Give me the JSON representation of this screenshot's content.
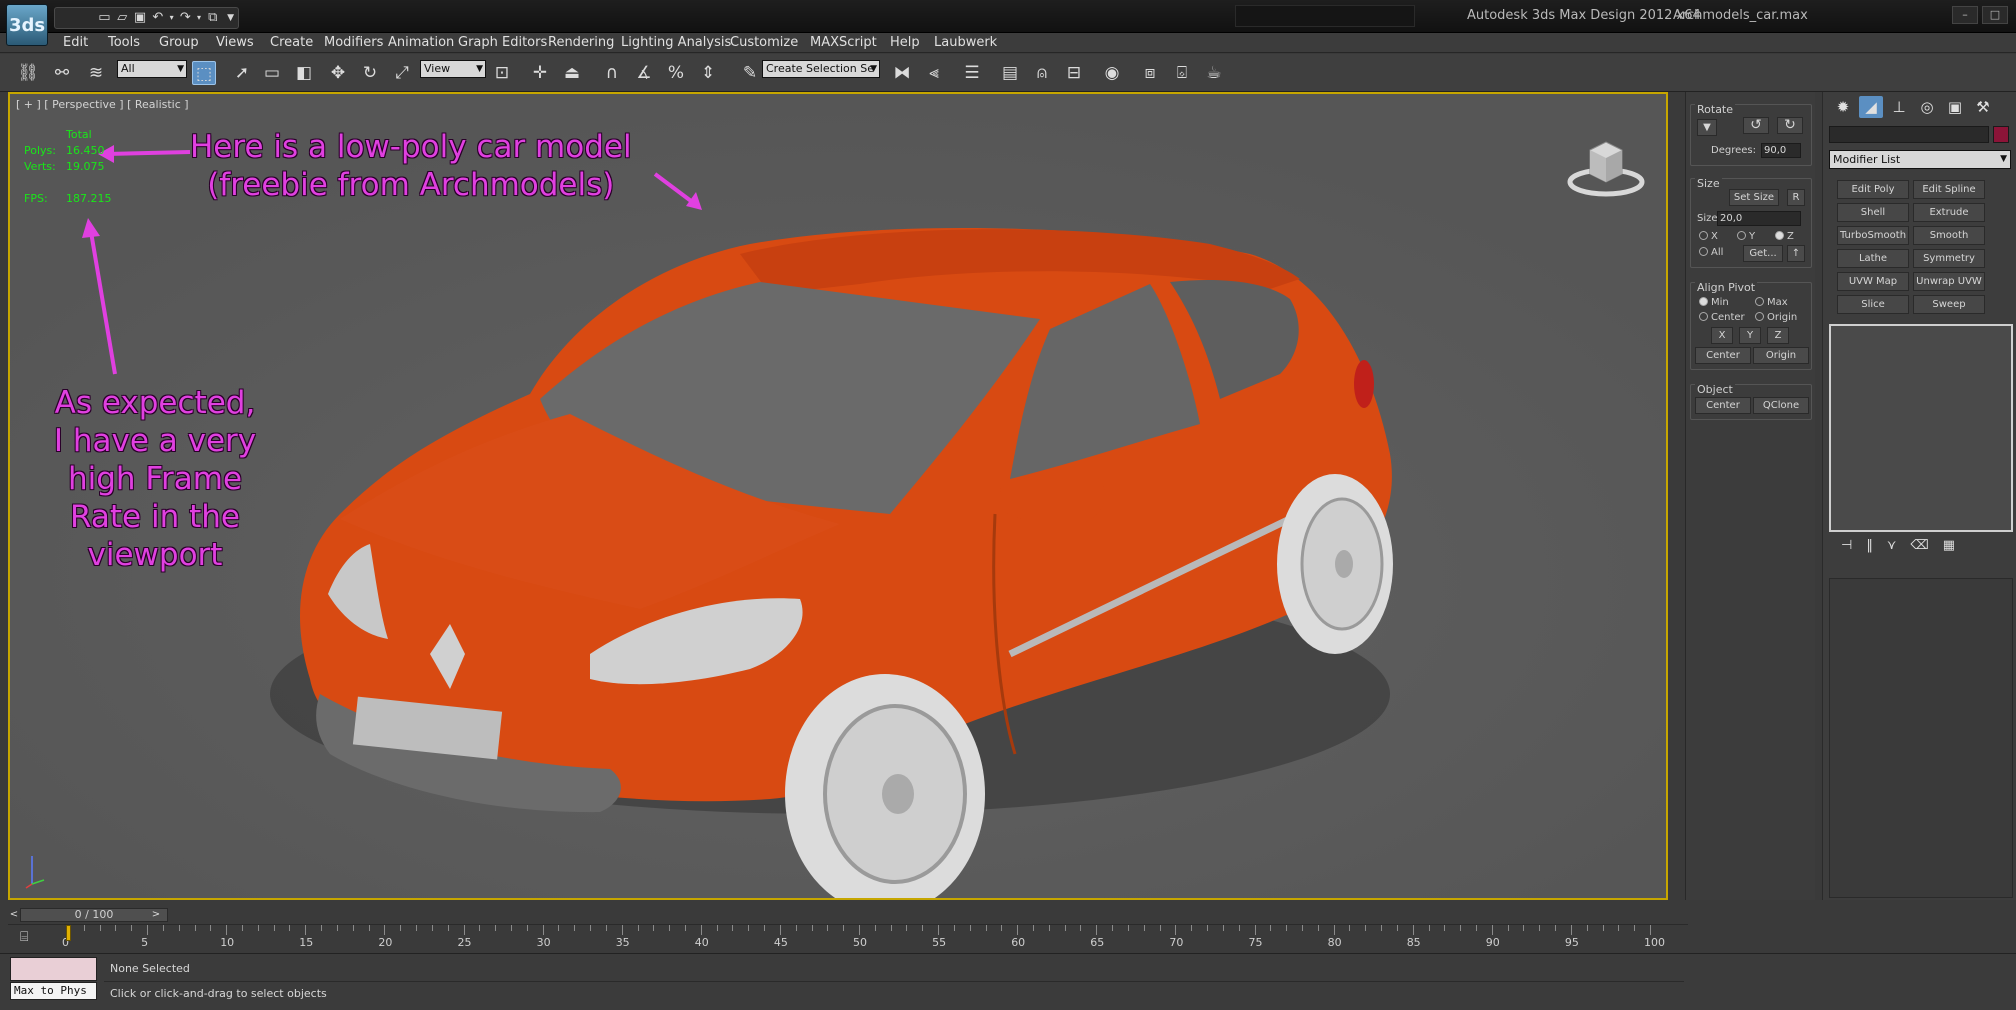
{
  "titlebar": {
    "app_title": "Autodesk 3ds Max Design 2012 x64",
    "file_title": "Archmodels_car.max",
    "logo_text": "3ds"
  },
  "menu": {
    "items": [
      "Edit",
      "Tools",
      "Group",
      "Views",
      "Create",
      "Modifiers",
      "Animation",
      "Graph Editors",
      "Rendering",
      "Lighting Analysis",
      "Customize",
      "MAXScript",
      "Help",
      "Laubwerk"
    ]
  },
  "toolbar": {
    "selection_filter": "All",
    "reference_coord": "View",
    "named_selection_placeholder": "Create Selection Se"
  },
  "viewport": {
    "label": "[ + ] [ Perspective ] [ Realistic ]",
    "stats": {
      "total_label": "Total",
      "polys_label": "Polys:",
      "polys_value": "16.450",
      "verts_label": "Verts:",
      "verts_value": "19.075",
      "fps_label": "FPS:",
      "fps_value": "187.215"
    },
    "annotations": {
      "top_line1": "Here is a low-poly car model",
      "top_line2": "(freebie from Archmodels)",
      "left_line1": "As expected,",
      "left_line2": "I have a very",
      "left_line3": "high Frame",
      "left_line4": "Rate in the",
      "left_line5": "viewport"
    },
    "car_color": "#d84a12",
    "annotation_color": "#e040e0",
    "background": "#5c5c5c"
  },
  "rollout_panel": {
    "rotate_title": "Rotate",
    "degrees_label": "Degrees:",
    "degrees_value": "90,0",
    "size_title": "Size",
    "set_size": "Set Size",
    "r_button": "R",
    "size_label": "Size",
    "size_value": "20,0",
    "axis_x": "X",
    "axis_y": "Y",
    "axis_z": "Z",
    "axis_all": "All",
    "get_button": "Get...",
    "align_pivot_title": "Align Pivot",
    "min": "Min",
    "max": "Max",
    "center": "Center",
    "origin": "Origin",
    "x": "X",
    "y": "Y",
    "z": "Z",
    "center_button": "Center",
    "origin_button": "Origin",
    "object_title": "Object",
    "object_center": "Center",
    "qclone": "QClone"
  },
  "command_panel": {
    "modifier_list": "Modifier List",
    "object_color": "#8c1438",
    "modifiers": [
      "Edit Poly",
      "Edit Spline",
      "Shell",
      "Extrude",
      "TurboSmooth",
      "Smooth",
      "Lathe",
      "Symmetry",
      "UVW Map",
      "Unwrap UVW",
      "Slice",
      "Sweep"
    ]
  },
  "timeline": {
    "slider": "0 / 100",
    "ticks": [
      "0",
      "5",
      "10",
      "15",
      "20",
      "25",
      "30",
      "35",
      "40",
      "45",
      "50",
      "55",
      "60",
      "65",
      "70",
      "75",
      "80",
      "85",
      "90",
      "95",
      "100"
    ]
  },
  "status": {
    "maxscript_label": "Max to Phys",
    "selection": "None Selected",
    "prompt": "Click or click-and-drag to select objects"
  }
}
